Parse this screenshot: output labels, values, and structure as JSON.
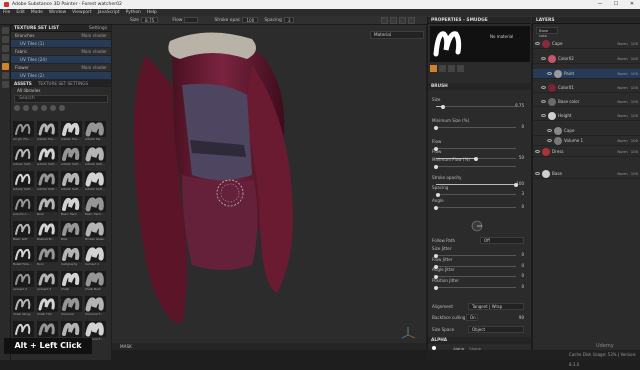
{
  "window": {
    "title": "Adobe Substance 3D Painter - Forest watcher02",
    "controls": [
      "—",
      "☐",
      "✕"
    ]
  },
  "menubar": [
    "File",
    "Edit",
    "Mode",
    "Window",
    "Viewport",
    "JavaScript",
    "Python",
    "Help"
  ],
  "toolbar": {
    "size_label": "Size",
    "size_value": "8.75",
    "flow_label": "Flow",
    "stroke_label": "Stroke opac",
    "stroke_value": "100",
    "spacing_label": "Spacing",
    "spacing_value": "3"
  },
  "texture_set_list": {
    "title": "TEXTURE SET LIST",
    "settings": "Settings",
    "rows": [
      {
        "name": "Branches",
        "shader": "Main shader",
        "sub": false
      },
      {
        "name": "UV Tiles (1)",
        "shader": "",
        "sub": true
      },
      {
        "name": "Fabric",
        "shader": "Main shader",
        "sub": false
      },
      {
        "name": "UV Tiles (24)",
        "shader": "",
        "sub": true
      },
      {
        "name": "Flower",
        "shader": "Main shader",
        "sub": false
      },
      {
        "name": "UV Tiles (2)",
        "shader": "",
        "sub": true
      }
    ]
  },
  "assets": {
    "tab_assets": "ASSETS",
    "tab_settings": "TEXTURE SET SETTINGS",
    "library": "All libraries",
    "search_placeholder": "Search",
    "items": [
      "Acrylic Fla...",
      "Artistic Hai...",
      "Artistic Hai...",
      "Artistic Pai...",
      "Artistic Soft...",
      "Artistic Soft...",
      "Artistic Soft...",
      "Artistic Soft...",
      "Artistic Soft...",
      "Artistic Soft...",
      "Artistic Soft...",
      "Artistic Soft...",
      "Autumn L...",
      "Bark",
      "Basic Hard",
      "Basic Hard...",
      "Basic Soft",
      "Bashed Br...",
      "Blob",
      "Broken Glass",
      "Bullet Hole...",
      "Burn",
      "Calligraphy",
      "Cement 1",
      "Cement 2",
      "Cement 3",
      "Chalk",
      "Chalk Bold",
      "Chalk Stong",
      "Chalk Thin",
      "Charcoal",
      "Charcoal F...",
      "Charcoal L...",
      "Charcoal L...",
      "Charcoal M...",
      "Charcoal F..."
    ]
  },
  "viewport": {
    "mode": "Material",
    "bottom_label": "MASK"
  },
  "caption": "Alt + Left Click",
  "properties": {
    "title": "PROPERTIES - SMUDGE",
    "preview_label": "No material",
    "brush_section": "BRUSH",
    "rows": [
      {
        "label": "Size",
        "value": "8.75",
        "pct": 0.09
      },
      {
        "label": "Minimum Size (%)",
        "value": "0",
        "pct": 0.0
      },
      {
        "label": "Flow",
        "value": "",
        "pct": 0.0
      },
      {
        "label": "Flow",
        "value": "50",
        "pct": 0.5
      },
      {
        "label": "Minimum Flow (%)",
        "value": "",
        "pct": 0.0
      },
      {
        "label": "Stroke opacity",
        "value": "100",
        "pct": 1.0
      },
      {
        "label": "Spacing",
        "value": "3",
        "pct": 0.03
      },
      {
        "label": "Angle",
        "value": "0",
        "pct": 0.0
      },
      {
        "label": "Size Jitter",
        "value": "0",
        "pct": 0.0
      },
      {
        "label": "Flow Jitter",
        "value": "0",
        "pct": 0.0
      },
      {
        "label": "Angle Jitter",
        "value": "0",
        "pct": 0.0
      },
      {
        "label": "Position Jitter",
        "value": "0",
        "pct": 0.0
      }
    ],
    "follow_path": {
      "label": "Follow Path",
      "value": "Off"
    },
    "alignment": {
      "label": "Alignment",
      "value": "Tangent | Wrap"
    },
    "backface": {
      "label": "Backface culling",
      "value": "On",
      "num": "90"
    },
    "size_space": {
      "label": "Size Space",
      "value": "Object"
    },
    "alpha_section": "ALPHA",
    "alpha_name": "Alpha",
    "alpha_sub": "Shape"
  },
  "layers": {
    "title": "LAYERS",
    "blend": "Base colo",
    "rows": [
      {
        "name": "Cape",
        "blend": "Norm",
        "opacity": "100",
        "color": "#8a2a38",
        "indent": 0
      },
      {
        "name": "Color02",
        "blend": "Norm",
        "opacity": "100",
        "color": "#c9556a",
        "indent": 1
      },
      {
        "name": "Paint",
        "blend": "Norm",
        "opacity": "100",
        "color": "#9a9a9a",
        "indent": 2
      },
      {
        "name": "Color01",
        "blend": "Norm",
        "opacity": "100",
        "color": "#7b2233",
        "indent": 1
      },
      {
        "name": "Base color",
        "blend": "Norm",
        "opacity": "100",
        "color": "#6b6b6b",
        "indent": 1
      },
      {
        "name": "Height",
        "blend": "Norm",
        "opacity": "100",
        "color": "#d0d0d0",
        "indent": 1
      },
      {
        "name": "Cape",
        "blend": "",
        "opacity": "",
        "color": "#888",
        "indent": 2
      },
      {
        "name": "Volume 1",
        "blend": "Norm",
        "opacity": "100",
        "color": "#777",
        "indent": 2
      },
      {
        "name": "Dress",
        "blend": "Norm",
        "opacity": "100",
        "color": "#a33",
        "indent": 0
      },
      {
        "name": "Base",
        "blend": "Norm",
        "opacity": "100",
        "color": "#cfcfcf",
        "indent": 0
      }
    ]
  },
  "status": "Cache Disk Usage: 53% | Version: 8.3.0",
  "watermark": "Udemy",
  "colors": {
    "accent": "#d28228",
    "selection": "#253b58",
    "cape": "#6e1d33"
  }
}
